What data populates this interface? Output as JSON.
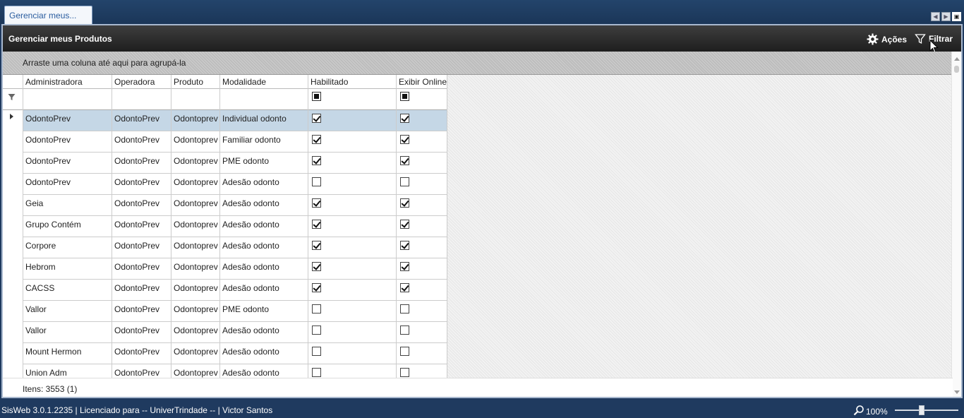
{
  "tab": {
    "label": "Gerenciar meus..."
  },
  "window": {
    "title": "Gerenciar meus Produtos",
    "actions_label": "Ações",
    "filter_label": "Filtrar"
  },
  "group_panel": {
    "text": "Arraste uma coluna até aqui para agrupá-la"
  },
  "columns": [
    "Administradora",
    "Operadora",
    "Produto",
    "Modalidade",
    "Habilitado",
    "Exibir Online"
  ],
  "rows": [
    {
      "administradora": "OdontoPrev",
      "operadora": "OdontoPrev",
      "produto": "Odontoprev",
      "modalidade": "Individual odonto",
      "habilitado": true,
      "exibir_online": true
    },
    {
      "administradora": "OdontoPrev",
      "operadora": "OdontoPrev",
      "produto": "Odontoprev",
      "modalidade": "Familiar odonto",
      "habilitado": true,
      "exibir_online": true
    },
    {
      "administradora": "OdontoPrev",
      "operadora": "OdontoPrev",
      "produto": "Odontoprev",
      "modalidade": "PME odonto",
      "habilitado": true,
      "exibir_online": true
    },
    {
      "administradora": "OdontoPrev",
      "operadora": "OdontoPrev",
      "produto": "Odontoprev",
      "modalidade": "Adesão odonto",
      "habilitado": false,
      "exibir_online": false
    },
    {
      "administradora": "Geia",
      "operadora": "OdontoPrev",
      "produto": "Odontoprev",
      "modalidade": "Adesão odonto",
      "habilitado": true,
      "exibir_online": true
    },
    {
      "administradora": "Grupo Contém",
      "operadora": "OdontoPrev",
      "produto": "Odontoprev",
      "modalidade": "Adesão odonto",
      "habilitado": true,
      "exibir_online": true
    },
    {
      "administradora": "Corpore",
      "operadora": "OdontoPrev",
      "produto": "Odontoprev",
      "modalidade": "Adesão odonto",
      "habilitado": true,
      "exibir_online": true
    },
    {
      "administradora": "Hebrom",
      "operadora": "OdontoPrev",
      "produto": "Odontoprev",
      "modalidade": "Adesão odonto",
      "habilitado": true,
      "exibir_online": true
    },
    {
      "administradora": "CACSS",
      "operadora": "OdontoPrev",
      "produto": "Odontoprev",
      "modalidade": "Adesão odonto",
      "habilitado": true,
      "exibir_online": true
    },
    {
      "administradora": "Vallor",
      "operadora": "OdontoPrev",
      "produto": "Odontoprev",
      "modalidade": "PME odonto",
      "habilitado": false,
      "exibir_online": false
    },
    {
      "administradora": "Vallor",
      "operadora": "OdontoPrev",
      "produto": "Odontoprev",
      "modalidade": "Adesão odonto",
      "habilitado": false,
      "exibir_online": false
    },
    {
      "administradora": "Mount Hermon",
      "operadora": "OdontoPrev",
      "produto": "Odontoprev",
      "modalidade": "Adesão odonto",
      "habilitado": false,
      "exibir_online": false
    },
    {
      "administradora": "Union Adm",
      "operadora": "OdontoPrev",
      "produto": "Odontoprev",
      "modalidade": "Adesão odonto",
      "habilitado": false,
      "exibir_online": false
    }
  ],
  "selected_row_index": 0,
  "footer": {
    "items_count": "Itens: 3553 (1)"
  },
  "status_bar": {
    "text": "SisWeb 3.0.1.2235 | Licenciado para -- UniverTrindade -- | Victor Santos",
    "zoom": "100%"
  },
  "colors": {
    "selected_row": "#c5d7e6",
    "title_bar": "#2b2b2b",
    "app_frame": "#1f3a5f"
  }
}
